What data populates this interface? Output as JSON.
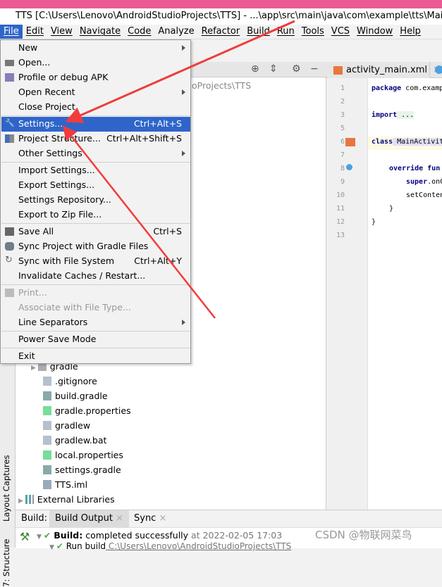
{
  "window": {
    "title": "TTS [C:\\Users\\Lenovo\\AndroidStudioProjects\\TTS] - ...\\app\\src\\main\\java\\com\\example\\tts\\MainActivity.kt"
  },
  "menubar": [
    "File",
    "Edit",
    "View",
    "Navigate",
    "Code",
    "Analyze",
    "Refactor",
    "Build",
    "Run",
    "Tools",
    "VCS",
    "Window",
    "Help"
  ],
  "file_menu": {
    "new": "New",
    "open": "Open...",
    "profile": "Profile or debug APK",
    "open_recent": "Open Recent",
    "close_project": "Close Project",
    "settings": "Settings...",
    "settings_sc": "Ctrl+Alt+S",
    "project_structure": "Project Structure...",
    "project_structure_sc": "Ctrl+Alt+Shift+S",
    "other_settings": "Other Settings",
    "import_settings": "Import Settings...",
    "export_settings": "Export Settings...",
    "settings_repo": "Settings Repository...",
    "export_zip": "Export to Zip File...",
    "save_all": "Save All",
    "save_all_sc": "Ctrl+S",
    "sync_gradle": "Sync Project with Gradle Files",
    "sync_fs": "Sync with File System",
    "sync_fs_sc": "Ctrl+Alt+Y",
    "invalidate": "Invalidate Caches / Restart...",
    "print": "Print...",
    "associate": "Associate with File Type...",
    "line_separators": "Line Separators",
    "power_save": "Power Save Mode",
    "exit": "Exit"
  },
  "project": {
    "path_partial": "oProjects\\TTS",
    "tree": [
      "gradle",
      ".gitignore",
      "build.gradle",
      "gradle.properties",
      "gradlew",
      "gradlew.bat",
      "local.properties",
      "settings.gradle",
      "TTS.iml",
      "External Libraries"
    ]
  },
  "side_tabs": {
    "layout_captures": "Layout Captures",
    "structure": "7: Structure"
  },
  "editor": {
    "tab": "activity_main.xml",
    "line_numbers": [
      "1",
      "2",
      "3",
      "5",
      "6",
      "7",
      "8",
      "9",
      "10",
      "11",
      "12",
      "13"
    ],
    "code": {
      "l1_kw": "package",
      "l1": " com.examp",
      "l3_kw": "import",
      "l3": " ...",
      "l6_kw": "class",
      "l6": " MainActivit",
      "l8_kw": "override fun",
      "l9_kw": "super",
      "l9": ".onC",
      "l10": "setConten",
      "l11": "}",
      "l12": "}"
    }
  },
  "build": {
    "label": "Build:",
    "tabs": [
      "Build Output",
      "Sync"
    ],
    "status_bold": "Build:",
    "status": " completed successfully",
    "status_time": " at 2022-02-05 17:03",
    "run_build": "Run build",
    "run_path": " C:\\Users\\Lenovo\\AndroidStudioProjects\\TTS"
  },
  "watermark": "CSDN @物联网菜鸟",
  "colors": {
    "accent": "#2f65ca",
    "annotation_arrow": "#f03c3c",
    "success": "#4caf50"
  }
}
